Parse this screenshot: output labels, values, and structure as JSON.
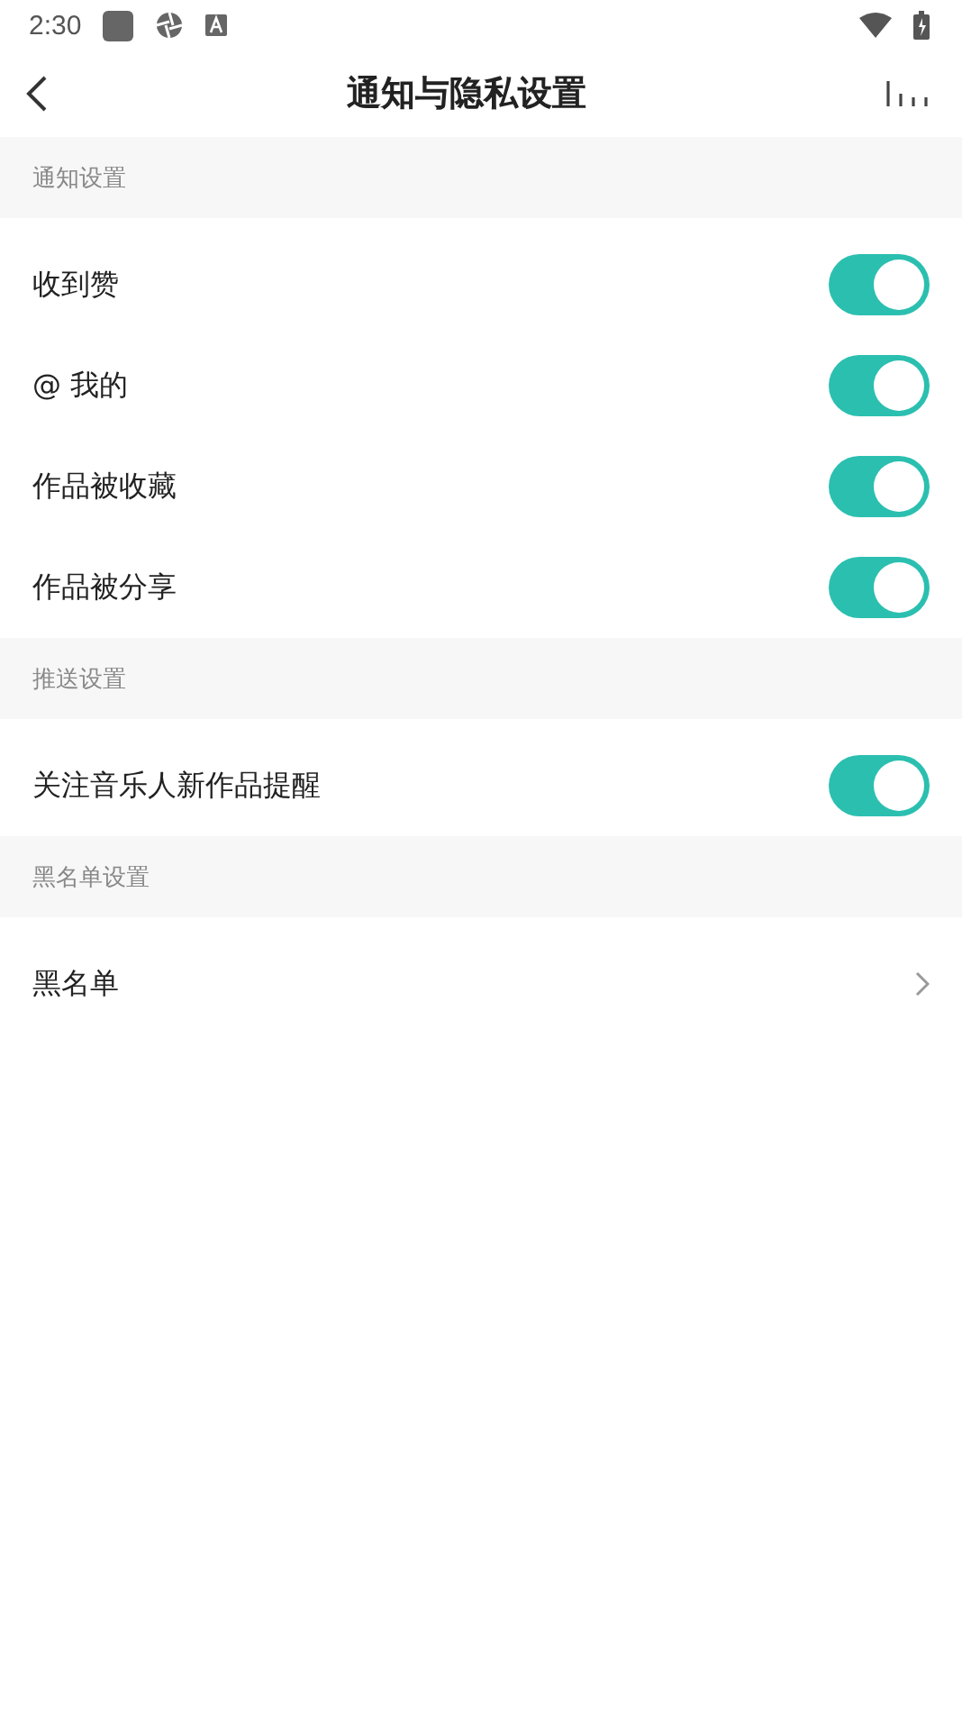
{
  "status_bar": {
    "time": "2:30"
  },
  "header": {
    "title": "通知与隐私设置"
  },
  "sections": [
    {
      "title": "通知设置",
      "items": [
        {
          "kind": "toggle",
          "label": "收到赞",
          "on": true
        },
        {
          "kind": "toggle",
          "label": "@ 我的",
          "on": true
        },
        {
          "kind": "toggle",
          "label": "作品被收藏",
          "on": true
        },
        {
          "kind": "toggle",
          "label": "作品被分享",
          "on": true
        }
      ]
    },
    {
      "title": "推送设置",
      "items": [
        {
          "kind": "toggle",
          "label": "关注音乐人新作品提醒",
          "on": true
        }
      ]
    },
    {
      "title": "黑名单设置",
      "items": [
        {
          "kind": "link",
          "label": "黑名单"
        }
      ]
    }
  ]
}
